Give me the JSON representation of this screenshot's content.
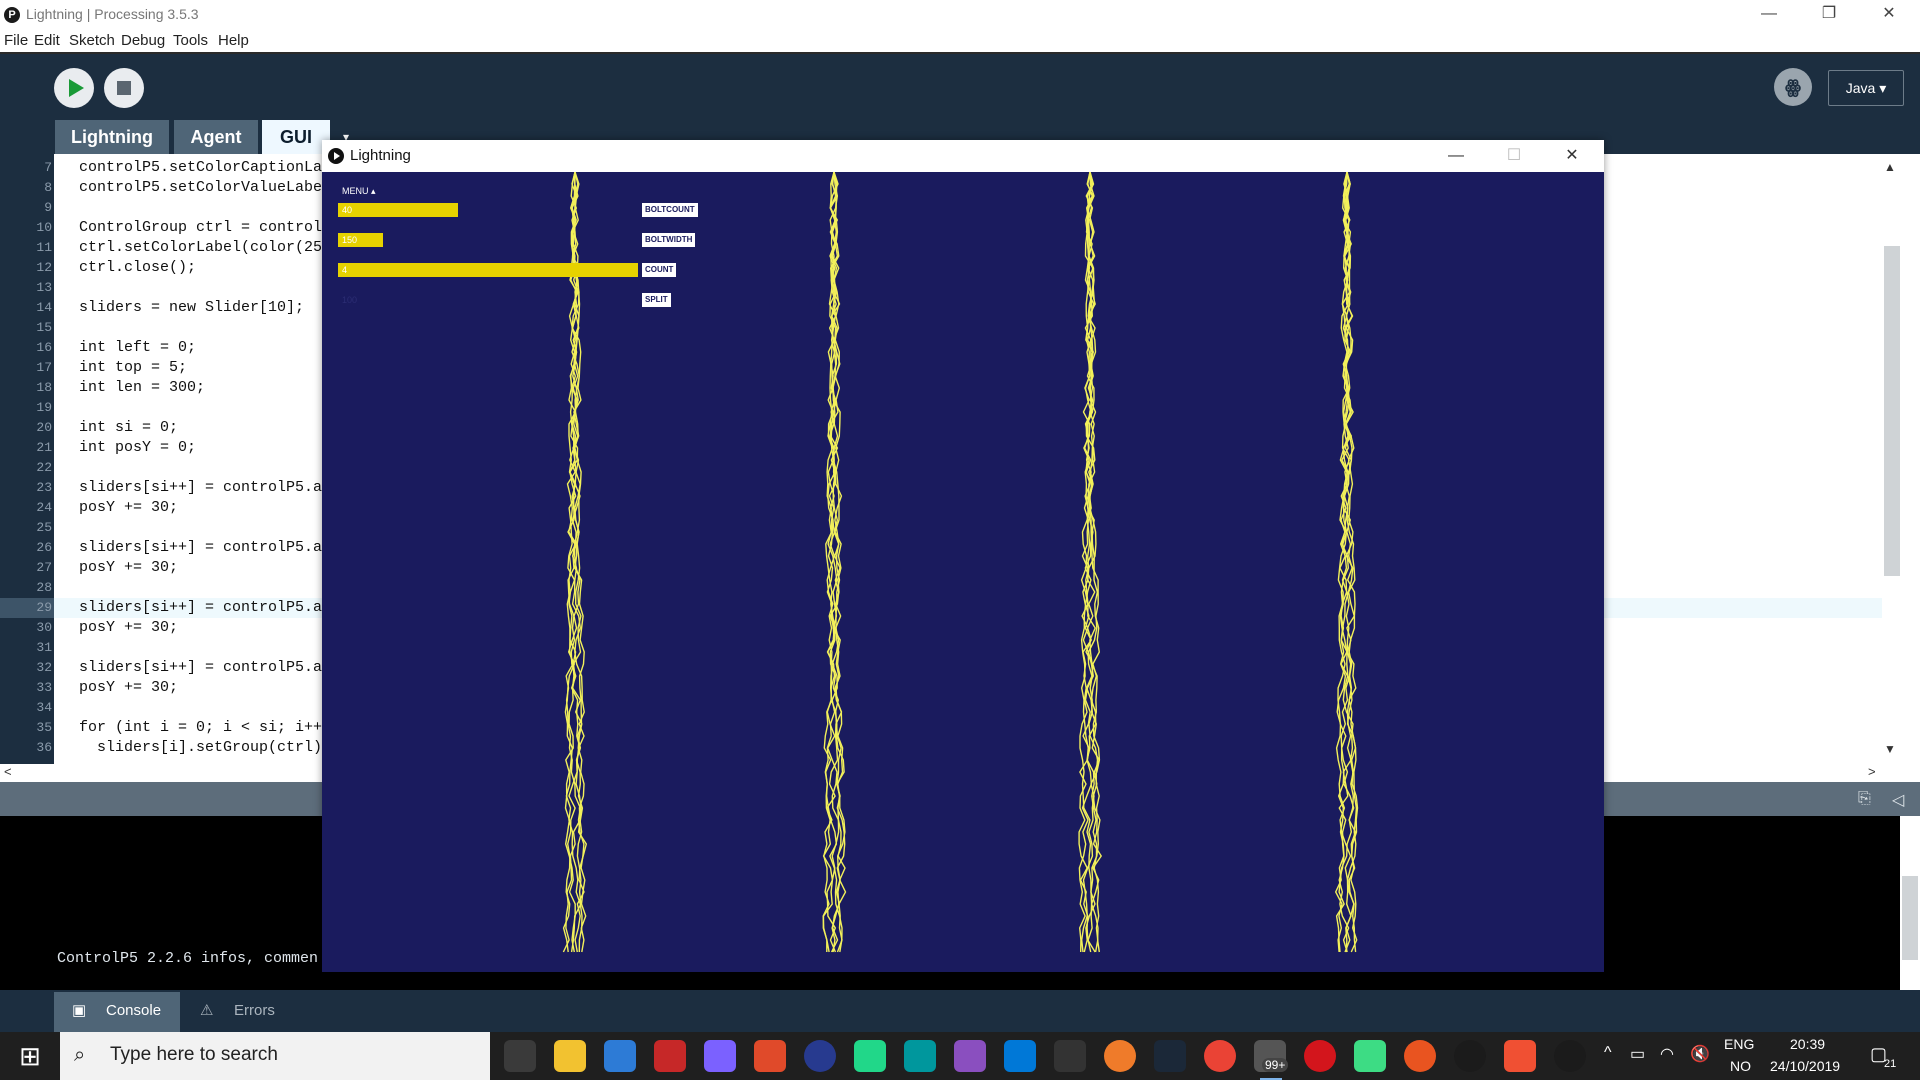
{
  "window": {
    "title": "Lightning | Processing 3.5.3",
    "logo": "p-logo-icon"
  },
  "menu": [
    "File",
    "Edit",
    "Sketch",
    "Debug",
    "Tools",
    "Help"
  ],
  "toolbar": {
    "run": "play-icon",
    "stop": "stop-icon",
    "mode_icon": "debug-butterfly-icon",
    "mode": "Java ▾"
  },
  "tabs": [
    {
      "label": "Lightning"
    },
    {
      "label": "Agent"
    },
    {
      "label": "GUI"
    }
  ],
  "tab_arrow": "▾",
  "editor": {
    "current_line": 29,
    "line_numbers": [
      "7",
      "8",
      "9",
      "10",
      "11",
      "12",
      "13",
      "14",
      "15",
      "16",
      "17",
      "18",
      "19",
      "20",
      "21",
      "22",
      "23",
      "24",
      "25",
      "26",
      "27",
      "28",
      "29",
      "30",
      "31",
      "32",
      "33",
      "34",
      "35",
      "36"
    ],
    "lines": [
      "controlP5.setColorCaptionLa",
      "controlP5.setColorValueLabe",
      "",
      "ControlGroup ctrl = control",
      "ctrl.setColorLabel(color(25",
      "ctrl.close();",
      "",
      "sliders = new Slider[10];",
      "",
      "int left = 0;",
      "int top = 5;",
      "int len = 300;",
      "",
      "int si = 0;",
      "int posY = 0;",
      "",
      "sliders[si++] = controlP5.a",
      "posY += 30;",
      "",
      "sliders[si++] = controlP5.a",
      "posY += 30;",
      "",
      "sliders[si++] = controlP5.a",
      "posY += 30;",
      "",
      "sliders[si++] = controlP5.a",
      "posY += 30;",
      "",
      "for (int i = 0; i < si; i++",
      "  sliders[i].setGroup(ctrl)"
    ]
  },
  "console": {
    "text": "ControlP5 2.2.6 infos, commen"
  },
  "footer_tabs": [
    {
      "label": "Console",
      "icon": "console-icon"
    },
    {
      "label": "Errors",
      "icon": "warning-icon"
    }
  ],
  "sketch": {
    "title": "Lightning",
    "menu_label": "MENU ▴",
    "background": "#1a1b5e",
    "bolt_color": "#f2f05a",
    "sliders": [
      {
        "label": "BOLTCOUNT",
        "value": "40",
        "fill": 0.4
      },
      {
        "label": "BOLTWIDTH",
        "value": "150",
        "fill": 0.15
      },
      {
        "label": "COUNT",
        "value": "4",
        "fill": 1.0
      },
      {
        "label": "SPLIT",
        "value": "100",
        "fill": 0.0
      }
    ],
    "bolts": 4
  },
  "taskbar": {
    "search_placeholder": "Type here to search",
    "apps": [
      "task-view-icon",
      "file-explorer-icon",
      "store-icon",
      "gift-icon",
      "app-icon",
      "app-icon",
      "eclipse-icon",
      "pycharm-icon",
      "arduino-icon",
      "visual-studio-icon",
      "vscode-icon",
      "epic-games-icon",
      "blender-icon",
      "steam-icon",
      "chrome-icon",
      "mail-icon",
      "opera-icon",
      "android-studio-icon",
      "ubuntu-icon",
      "processing-icon",
      "git-icon",
      "processing-run-icon"
    ],
    "mail_badge": "99+",
    "lang_top": "ENG",
    "lang_bottom": "NO",
    "time": "20:39",
    "date": "24/10/2019",
    "notif": "21"
  }
}
